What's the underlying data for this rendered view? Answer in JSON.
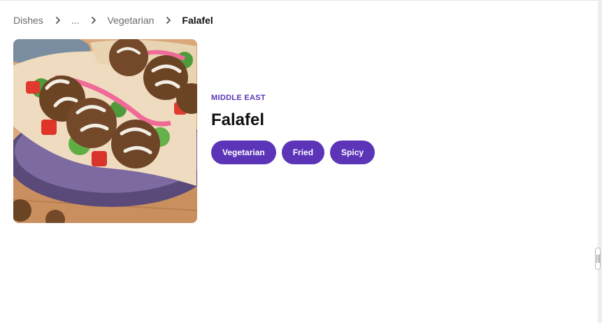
{
  "breadcrumb": {
    "items": [
      {
        "label": "Dishes"
      },
      {
        "label": "..."
      },
      {
        "label": "Vegetarian"
      }
    ],
    "current": "Falafel"
  },
  "dish": {
    "region": "MIDDLE EAST",
    "title": "Falafel",
    "tags": [
      "Vegetarian",
      "Fried",
      "Spicy"
    ]
  },
  "colors": {
    "accent": "#5b34b8"
  }
}
